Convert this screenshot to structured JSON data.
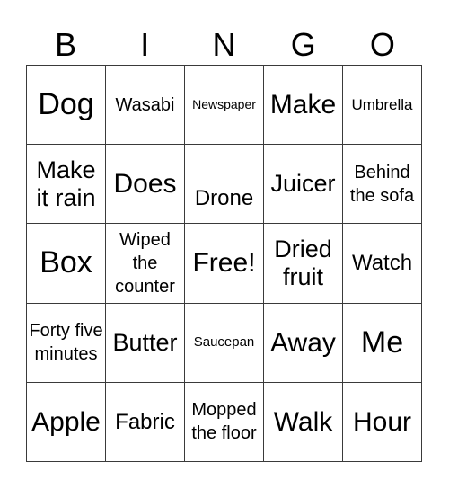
{
  "header": {
    "letters": [
      "B",
      "I",
      "N",
      "G",
      "O"
    ]
  },
  "grid": {
    "rows": [
      [
        "Dog",
        "Wasabi",
        "Newspaper",
        "Make",
        "Umbrella"
      ],
      [
        "Make it rain",
        "Does",
        "Drone",
        "Juicer",
        "Behind the sofa"
      ],
      [
        "Box",
        "Wiped the counter",
        "Free!",
        "Dried fruit",
        "Watch"
      ],
      [
        "Forty five minutes",
        "Butter",
        "Saucepan",
        "Away",
        "Me"
      ],
      [
        "Apple",
        "Fabric",
        "Mopped the floor",
        "Walk",
        "Hour"
      ]
    ]
  }
}
